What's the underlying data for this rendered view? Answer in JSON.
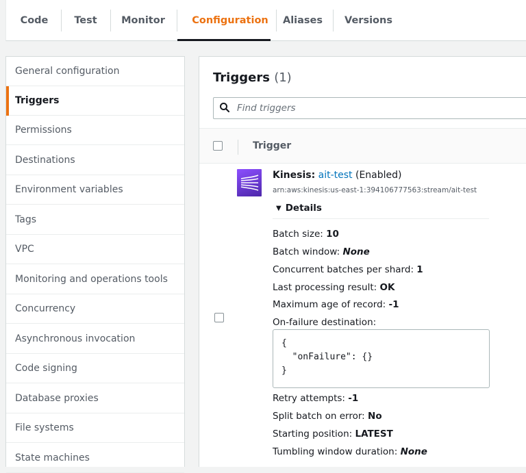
{
  "tabs": [
    "Code",
    "Test",
    "Monitor",
    "Configuration",
    "Aliases",
    "Versions"
  ],
  "active_tab": "Configuration",
  "sidebar": {
    "items": [
      {
        "label": "General configuration"
      },
      {
        "label": "Triggers"
      },
      {
        "label": "Permissions"
      },
      {
        "label": "Destinations"
      },
      {
        "label": "Environment variables"
      },
      {
        "label": "Tags"
      },
      {
        "label": "VPC"
      },
      {
        "label": "Monitoring and operations tools"
      },
      {
        "label": "Concurrency"
      },
      {
        "label": "Asynchronous invocation"
      },
      {
        "label": "Code signing"
      },
      {
        "label": "Database proxies"
      },
      {
        "label": "File systems"
      },
      {
        "label": "State machines"
      }
    ],
    "active": "Triggers"
  },
  "panel": {
    "title": "Triggers",
    "count": "(1)",
    "search_placeholder": "Find triggers",
    "column_header": "Trigger"
  },
  "trigger": {
    "service": "Kinesis",
    "separator": ":",
    "name": "ait-test",
    "state": "(Enabled)",
    "arn": "arn:aws:kinesis:us-east-1:394106777563:stream/ait-test",
    "details_label": "Details",
    "details_expanded": true,
    "properties": [
      {
        "label": "Batch size:",
        "value": "10",
        "italic": false
      },
      {
        "label": "Batch window:",
        "value": "None",
        "italic": true
      },
      {
        "label": "Concurrent batches per shard:",
        "value": "1",
        "italic": false
      },
      {
        "label": "Last processing result:",
        "value": "OK",
        "italic": false
      },
      {
        "label": "Maximum age of record:",
        "value": "-1",
        "italic": false
      },
      {
        "label": "On-failure destination:",
        "value": "",
        "italic": false
      }
    ],
    "on_failure_json": "{\n  \"onFailure\": {}\n}",
    "properties_after": [
      {
        "label": "Retry attempts:",
        "value": "-1",
        "italic": false
      },
      {
        "label": "Split batch on error:",
        "value": "No",
        "italic": false
      },
      {
        "label": "Starting position:",
        "value": "LATEST",
        "italic": false
      },
      {
        "label": "Tumbling window duration:",
        "value": "None",
        "italic": true
      }
    ]
  },
  "colors": {
    "accent": "#ec7211",
    "link": "#0073bb",
    "kinesis": "#8c4fff"
  }
}
